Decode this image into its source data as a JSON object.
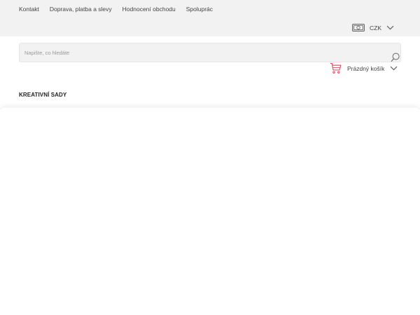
{
  "top_nav": {
    "items": [
      {
        "label": "Kontakt"
      },
      {
        "label": "Doprava, platba a slevy"
      },
      {
        "label": "Hodnocení obchodu"
      },
      {
        "label": "Spolupráce"
      }
    ]
  },
  "currency": {
    "icon": "money-icon",
    "label": "CZK"
  },
  "search": {
    "placeholder": "Napište, co hledáte",
    "value": ""
  },
  "cart": {
    "icon": "cart-icon",
    "label": "Prázdný košík",
    "accent_color": "#e2465c"
  },
  "category": {
    "title": "KREATIVNÍ SADY"
  }
}
